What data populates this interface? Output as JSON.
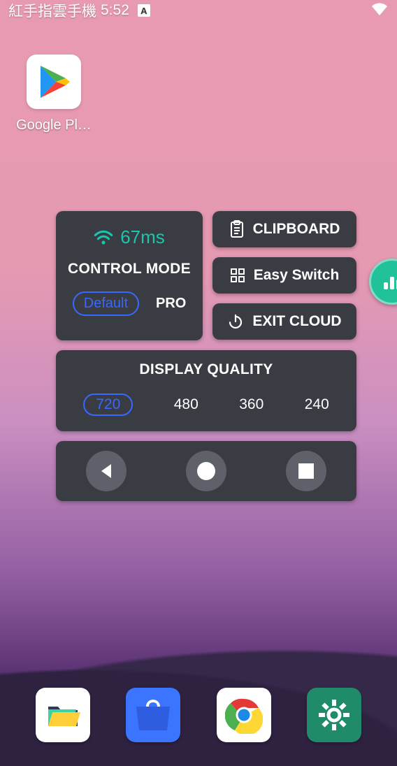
{
  "statusbar": {
    "carrier": "紅手指雲手機",
    "clock": "5:52",
    "kbd_badge": "A"
  },
  "home": {
    "play_label": "Google Pl…"
  },
  "panel": {
    "latency": "67ms",
    "control_mode_title": "CONTROL MODE",
    "mode": {
      "selected": "Default",
      "other": "PRO"
    },
    "side": {
      "clipboard": "CLIPBOARD",
      "easy_switch": "Easy Switch",
      "exit_cloud": "EXIT CLOUD"
    },
    "display_quality": {
      "title": "DISPLAY QUALITY",
      "options": [
        "720",
        "480",
        "360",
        "240"
      ],
      "selected": "720"
    }
  },
  "dock": {
    "files": "files-app",
    "store": "app-store",
    "chrome": "chrome-browser",
    "settings": "settings-app"
  }
}
